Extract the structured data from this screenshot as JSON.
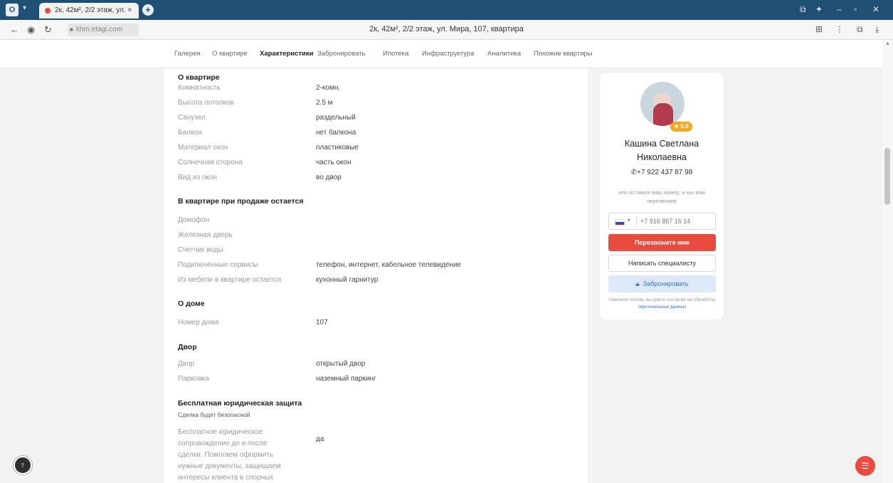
{
  "browser": {
    "tab_title": "2к, 42м², 2/2 этаж, ул. ×",
    "url": "khm.etagi.com",
    "page_title": "2к, 42м², 2/2 этаж, ул. Мира, 107, квартира"
  },
  "nav": {
    "items": [
      "Галерея",
      "О квартире",
      "Характеристики",
      "Забронировать",
      "Ипотека",
      "Инфраструктура",
      "Аналитика",
      "Похожие квартиры"
    ],
    "active": "Характеристики"
  },
  "sections": {
    "apartment": {
      "title": "О квартире",
      "rows": [
        {
          "label": "Комнатность",
          "value": "2-комн."
        },
        {
          "label": "Высота потолков",
          "value": "2.5 м"
        },
        {
          "label": "Санузел",
          "value": "раздельный"
        },
        {
          "label": "Балкон",
          "value": "нет балкона"
        },
        {
          "label": "Материал окон",
          "value": "пластиковые"
        },
        {
          "label": "Солнечная сторона",
          "value": "часть окон"
        },
        {
          "label": "Вид из окон",
          "value": "во двор"
        }
      ]
    },
    "remains": {
      "title": "В квартире при продаже остается",
      "rows": [
        {
          "label": "Домофон",
          "value": ""
        },
        {
          "label": "Железная дверь",
          "value": ""
        },
        {
          "label": "Счетчик воды",
          "value": ""
        },
        {
          "label": "Подключённые сервисы",
          "value": "телефон, интернет, кабельное телевидение"
        },
        {
          "label": "Из мебели в квартире остается",
          "value": "кухонный гарнитур"
        }
      ]
    },
    "house": {
      "title": "О доме",
      "rows": [
        {
          "label": "Номер дома",
          "value": "107"
        }
      ]
    },
    "yard": {
      "title": "Двор",
      "rows": [
        {
          "label": "Двор",
          "value": "открытый двор"
        },
        {
          "label": "Парковка",
          "value": "наземный паркинг"
        }
      ]
    },
    "legal": {
      "title": "Бесплатная юридическая защита",
      "subtitle": "Сделка будет безопасной",
      "label": "Бесплатное юридическое сопровождение до и после сделки. Помогаем оформить нужные документы, защищаем интересы клиента в спорных ситуациях",
      "value": "да"
    }
  },
  "agent": {
    "rating": "5.0",
    "name_line1": "Кашина Светлана",
    "name_line2": "Николаевна",
    "phone": "+7 922 437 87 98",
    "note": "или оставьте ваш номер, и мы вам перезвоним",
    "input_placeholder": "+7 916 857 16 14",
    "call_button": "Перезвоните мне",
    "write_button": "Написать специалисту",
    "book_button": "Забронировать",
    "legal_text": "Нажимая кнопку, вы даете согласие на обработку ",
    "legal_link": "персональных данных"
  },
  "colors": {
    "accent_red": "#ea4b3f",
    "accent_blue": "#3b73c4",
    "rating": "#f5a623"
  }
}
